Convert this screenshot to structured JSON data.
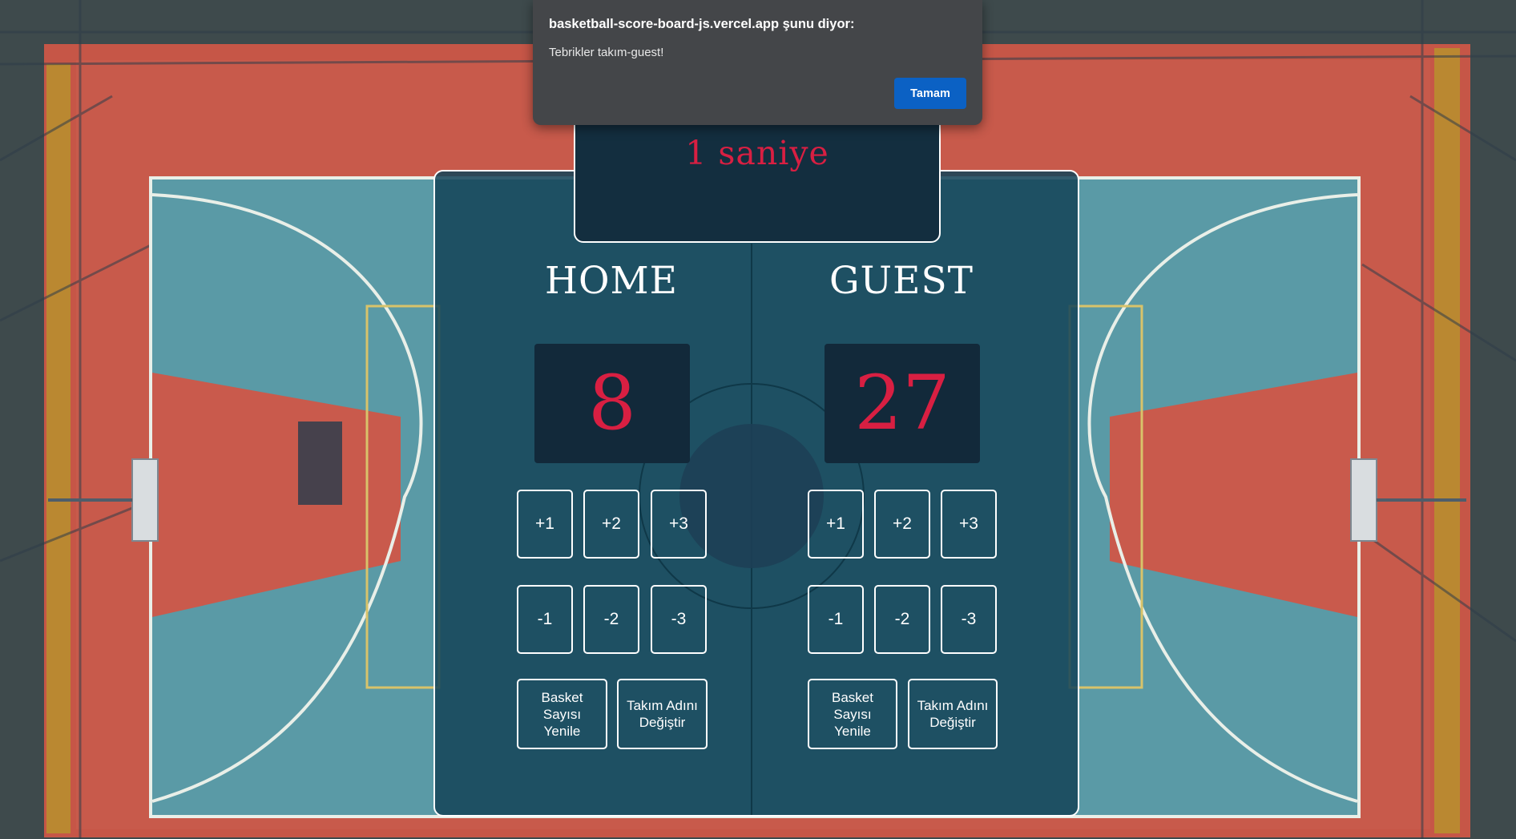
{
  "dialog": {
    "title": "basketball-score-board-js.vercel.app şunu diyor:",
    "message": "Tebrikler takım-guest!",
    "ok_label": "Tamam"
  },
  "timer": {
    "text": "1 saniye"
  },
  "home": {
    "name": "HOME",
    "score": "8",
    "add_buttons": [
      "+1",
      "+2",
      "+3"
    ],
    "sub_buttons": [
      "-1",
      "-2",
      "-3"
    ],
    "reset_label": "Basket Sayısı Yenile",
    "rename_label": "Takım Adını Değiştir"
  },
  "guest": {
    "name": "GUEST",
    "score": "27",
    "add_buttons": [
      "+1",
      "+2",
      "+3"
    ],
    "sub_buttons": [
      "-1",
      "-2",
      "-3"
    ],
    "reset_label": "Basket Sayısı Yenile",
    "rename_label": "Takım Adını Değiştir"
  },
  "colors": {
    "score_red": "#d81f42",
    "panel": "#144458",
    "dialog_button": "#0b61c4",
    "court_red": "#c8584a",
    "court_blue": "#5a9ea8"
  }
}
